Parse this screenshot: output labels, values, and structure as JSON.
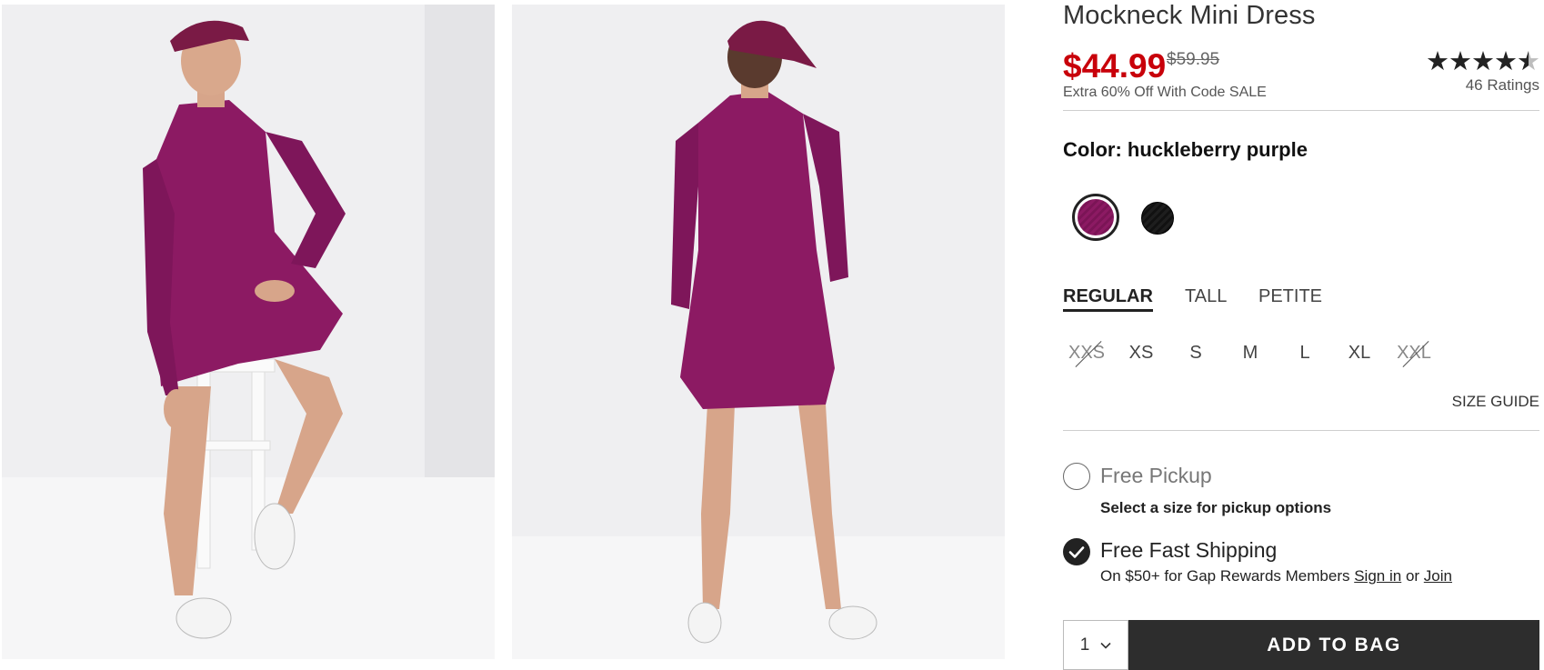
{
  "product": {
    "title": "Mockneck Mini Dress",
    "sale_price": "$44.99",
    "original_price": "$59.95",
    "promo": "Extra 60% Off With Code SALE",
    "rating_stars": 4.5,
    "ratings_label": "46 Ratings"
  },
  "images": [
    {
      "label": "front-view"
    },
    {
      "label": "back-view"
    }
  ],
  "color": {
    "label": "Color: huckleberry purple",
    "swatches": [
      {
        "name": "huckleberry purple",
        "hex": "#8c1a63",
        "selected": true
      },
      {
        "name": "black",
        "hex": "#1a1a1a",
        "selected": false
      }
    ]
  },
  "fit_tabs": [
    {
      "label": "REGULAR",
      "active": true
    },
    {
      "label": "TALL",
      "active": false
    },
    {
      "label": "PETITE",
      "active": false
    }
  ],
  "sizes": [
    {
      "label": "XXS",
      "available": false
    },
    {
      "label": "XS",
      "available": true
    },
    {
      "label": "S",
      "available": true
    },
    {
      "label": "M",
      "available": true
    },
    {
      "label": "L",
      "available": true
    },
    {
      "label": "XL",
      "available": true
    },
    {
      "label": "XXL",
      "available": false
    }
  ],
  "size_guide": "SIZE GUIDE",
  "fulfillment": {
    "pickup_label": "Free Pickup",
    "pickup_note": "Select a size for pickup options",
    "shipping_label": "Free Fast Shipping",
    "shipping_note": "On $50+ for Gap Rewards Members",
    "sign_in": "Sign in",
    "or": "or",
    "join": "Join"
  },
  "cart": {
    "quantity": "1",
    "add_label": "ADD TO BAG"
  },
  "colors": {
    "sale": "#c8000a",
    "button": "#2d2d2d",
    "dress": "#8c1a63"
  }
}
